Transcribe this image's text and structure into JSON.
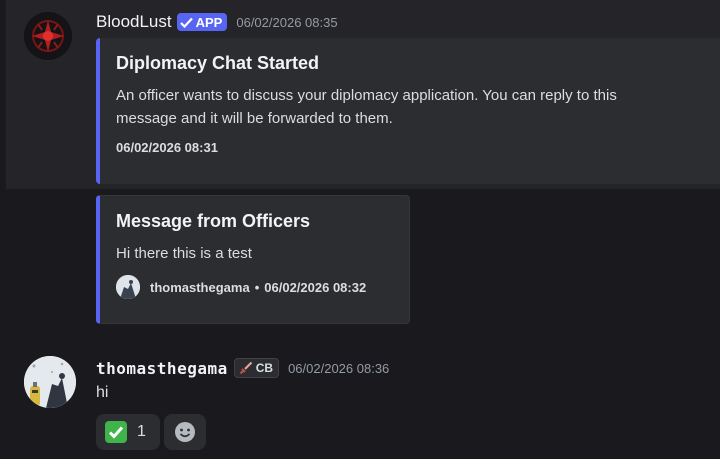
{
  "messages": [
    {
      "author": "BloodLust",
      "badge": "APP",
      "timestamp": "06/02/2026 08:35",
      "embeds": [
        {
          "title": "Diplomacy Chat Started",
          "description_line1": "An officer wants to discuss your diplomacy application. You can reply to this",
          "description_line2": "message and it will be forwarded to them.",
          "footer_timestamp": "06/02/2026 08:31"
        },
        {
          "title": "Message from Officers",
          "description": "Hi there this is a test",
          "footer_author": "thomasthegama",
          "footer_separator": "•",
          "footer_timestamp": "06/02/2026 08:32"
        }
      ]
    },
    {
      "author": "thomasthegama",
      "role_tag": "CB",
      "timestamp": "06/02/2026 08:36",
      "text": "hi",
      "reactions": [
        {
          "emoji": "white-check-mark-icon",
          "count": "1"
        },
        {
          "emoji": "add-reaction-icon"
        }
      ]
    }
  ],
  "colors": {
    "background": "#1a1a1e",
    "embed_bg": "#2b2d31",
    "embed_accent": "#5865f2",
    "app_badge": "#5865f2",
    "check": "#3fb44a"
  }
}
